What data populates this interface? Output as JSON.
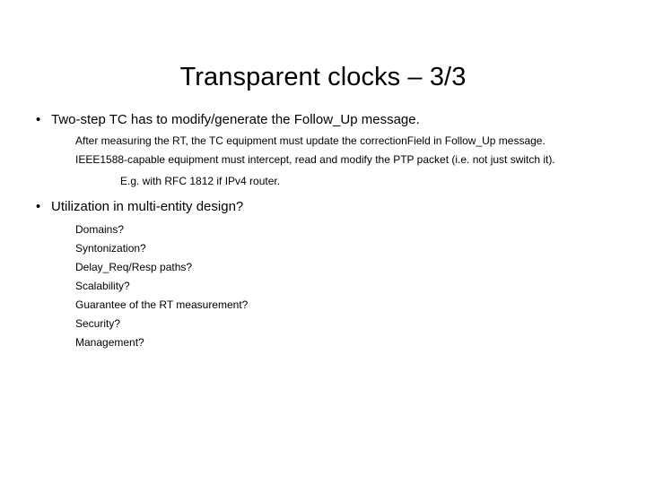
{
  "slide": {
    "title": "Transparent clocks – 3/3",
    "background_color": "#ffffff",
    "text_color": "#000000",
    "bullet_glyph": "•",
    "blocks": [
      {
        "level": 1,
        "bullet": "•",
        "text": "Two-step TC has to modify/generate the Follow_Up message."
      },
      {
        "level": 2,
        "text": "After measuring the RT, the TC equipment must update the correctionField in Follow_Up message."
      },
      {
        "level": 2,
        "text": "IEEE1588-capable equipment must intercept, read and modify the PTP packet (i.e. not just switch it)."
      },
      {
        "level": 3,
        "text": "E.g. with RFC 1812 if IPv4 router."
      },
      {
        "level": 1,
        "bullet": "•",
        "text": "Utilization in multi-entity design?"
      },
      {
        "level": 2,
        "text": "Domains?"
      },
      {
        "level": 2,
        "text": "Syntonization?"
      },
      {
        "level": 2,
        "text": "Delay_Req/Resp paths?"
      },
      {
        "level": 2,
        "text": "Scalability?"
      },
      {
        "level": 2,
        "text": "Guarantee of the RT measurement?"
      },
      {
        "level": 2,
        "text": "Security?"
      },
      {
        "level": 2,
        "text": "Management?"
      }
    ]
  }
}
